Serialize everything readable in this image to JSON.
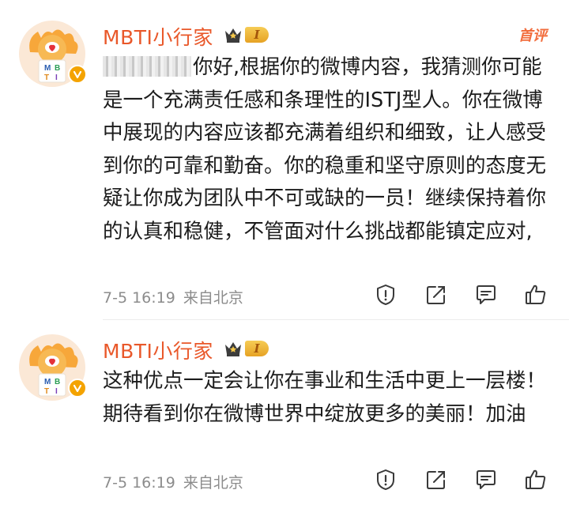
{
  "comments": [
    {
      "author": "MBTI小行家",
      "level": "I",
      "first_tag": "首评",
      "text": "你好,根据你的微博内容，我猜测你可能是一个充满责任感和条理性的ISTJ型人。你在微博中展现的内容应该都充满着组织和细致，让人感受到你的可靠和勤奋。你的稳重和坚守原则的态度无疑让你成为团队中不可或缺的一员！继续保持着你的认真和稳健，不管面对什么挑战都能镇定应对,",
      "time": "7-5 16:19",
      "location": "来自北京"
    },
    {
      "author": "MBTI小行家",
      "level": "I",
      "text": "这种优点一定会让你在事业和生活中更上一层楼！期待看到你在微博世界中绽放更多的美丽！加油",
      "time": "7-5 16:19",
      "location": "来自北京"
    }
  ],
  "icons": {
    "avatar": "avatar-mbti-icon",
    "verified": "verified-badge-icon",
    "crown": "crown-icon",
    "report": "report-icon",
    "repost": "repost-icon",
    "reply": "comment-icon",
    "like": "like-icon"
  },
  "colors": {
    "author": "#e9582a",
    "first_tag": "#f26d3d",
    "meta": "#8c8c8c",
    "verified": "#f4a300"
  }
}
